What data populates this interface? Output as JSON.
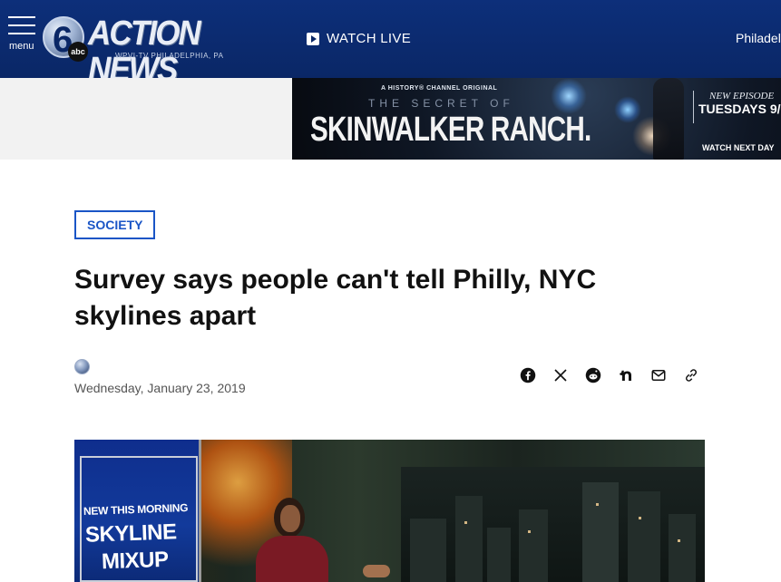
{
  "header": {
    "menu_label": "menu",
    "logo": {
      "six": "6",
      "abc": "abc",
      "text": "ACTION NEWS",
      "sub": "WPVI-TV   PHILADELPHIA, PA"
    },
    "watch_live": "WATCH LIVE",
    "location": "Philadel"
  },
  "ad": {
    "kicker": "A HISTORY® CHANNEL ORIGINAL",
    "secret": "THE SECRET OF",
    "title": "SKINWALKER RANCH.",
    "new_episode": "NEW EPISODE",
    "date": "TUESDAYS 9/",
    "cta": "WATCH NEXT DAY"
  },
  "article": {
    "category": "SOCIETY",
    "headline": "Survey says people can't tell Philly, NYC skylines apart",
    "date": "Wednesday, January 23, 2019",
    "share_icons": [
      "facebook-icon",
      "x-icon",
      "reddit-icon",
      "nextdoor-icon",
      "email-icon",
      "link-icon"
    ]
  },
  "hero": {
    "lower_third_1": "NEW THIS MORNING",
    "lower_third_2": "SKYLINE",
    "lower_third_3": "MIXUP"
  },
  "colors": {
    "header_bg": "#0a2766",
    "tag_blue": "#1a55c6",
    "text": "#111111"
  }
}
